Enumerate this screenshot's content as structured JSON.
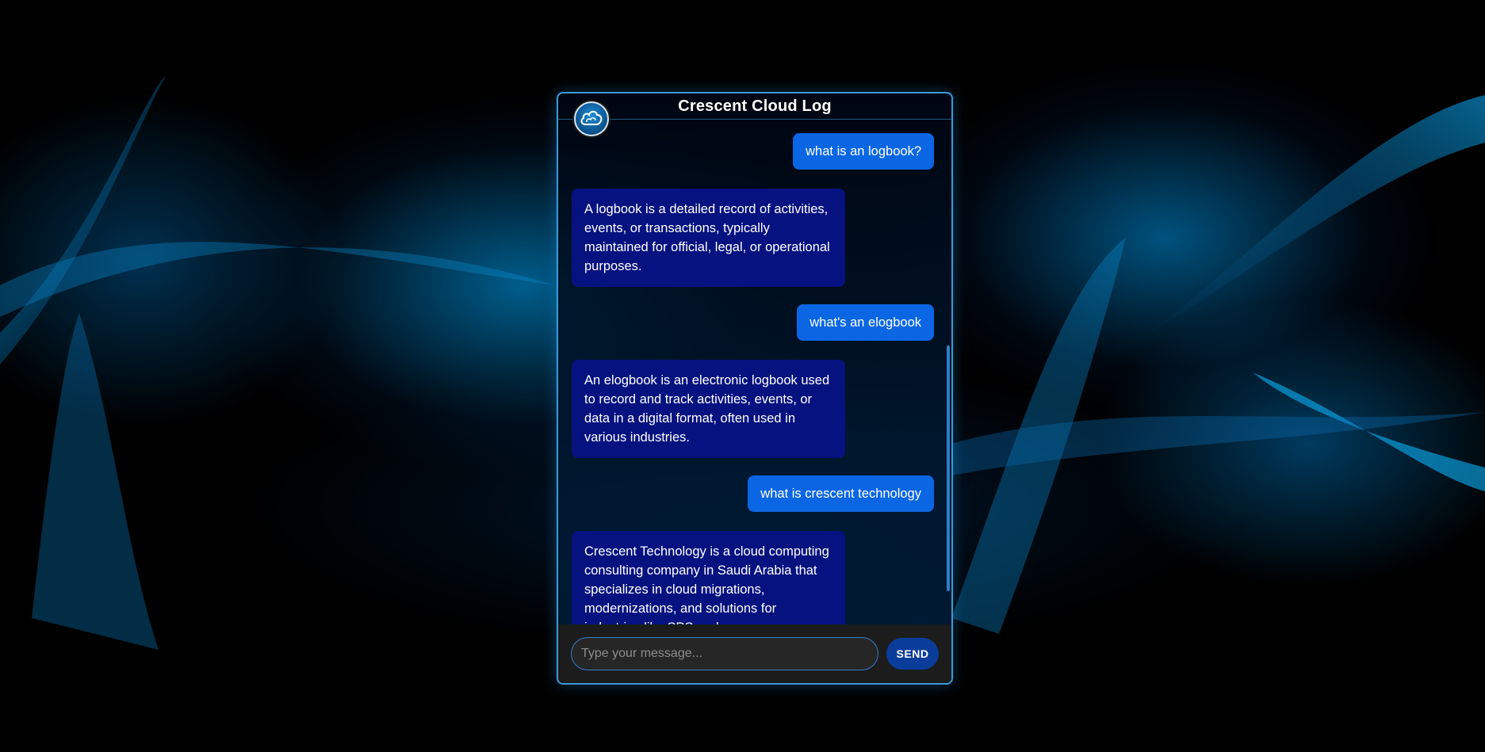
{
  "header": {
    "title": "Crescent Cloud Log",
    "avatar_icon": "cloud-icon"
  },
  "conversation": [
    {
      "role": "user",
      "text": "what is an logbook?"
    },
    {
      "role": "bot",
      "text": "A logbook is a detailed record of activities, events, or transactions, typically maintained for official, legal, or operational purposes."
    },
    {
      "role": "user",
      "text": "what's an elogbook"
    },
    {
      "role": "bot",
      "text": "An elogbook is an electronic logbook used to record and track activities, events, or data in a digital format, often used in various industries."
    },
    {
      "role": "user",
      "text": "what is crescent technology"
    },
    {
      "role": "bot",
      "text": "Crescent Technology is a cloud computing consulting company in Saudi Arabia that specializes in cloud migrations, modernizations, and solutions for industries like SPS and"
    }
  ],
  "composer": {
    "placeholder": "Type your message...",
    "value": "",
    "send_label": "SEND"
  },
  "colors": {
    "user_bubble": "#0b66e4",
    "bot_bubble": "#061280",
    "border_accent": "#3a9ad9",
    "send_button": "#0a3d9a"
  }
}
